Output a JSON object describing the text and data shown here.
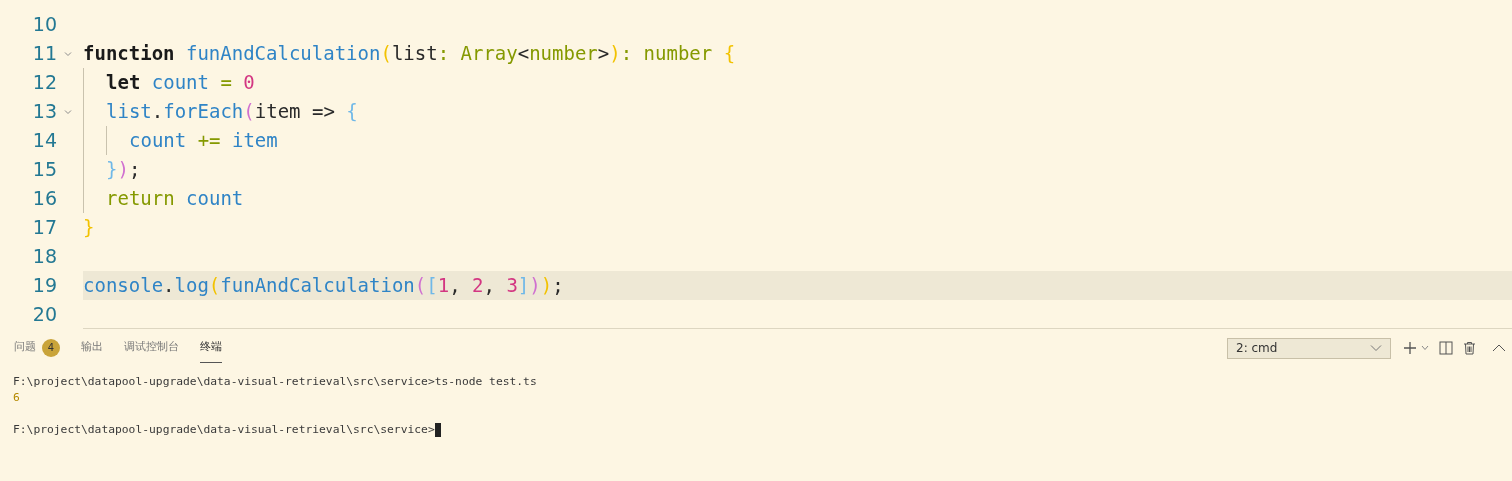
{
  "editor": {
    "lines": [
      {
        "number": "10"
      },
      {
        "number": "11",
        "expanded": true,
        "tokens": [
          {
            "kind": "keyword",
            "text": "function "
          },
          {
            "kind": "function",
            "text": "funAndCalculation"
          },
          {
            "kind": "bracket1",
            "text": "("
          },
          {
            "kind": "plain",
            "text": "list"
          },
          {
            "kind": "type",
            "text": ": Array"
          },
          {
            "kind": "plain",
            "text": "<"
          },
          {
            "kind": "type",
            "text": "number"
          },
          {
            "kind": "plain",
            "text": ">"
          },
          {
            "kind": "bracket1",
            "text": ")"
          },
          {
            "kind": "type",
            "text": ": number "
          },
          {
            "kind": "bracket1",
            "text": "{"
          }
        ],
        "children": [
          {
            "number": "12",
            "tokens": [
              {
                "kind": "keyword",
                "text": "let "
              },
              {
                "kind": "variable",
                "text": "count"
              },
              {
                "kind": "type",
                "text": " = "
              },
              {
                "kind": "number",
                "text": "0"
              }
            ]
          },
          {
            "number": "13",
            "expanded": true,
            "tokens": [
              {
                "kind": "variable",
                "text": "list"
              },
              {
                "kind": "plain",
                "text": "."
              },
              {
                "kind": "function",
                "text": "forEach"
              },
              {
                "kind": "bracket2",
                "text": "("
              },
              {
                "kind": "plain",
                "text": "item => "
              },
              {
                "kind": "bracket3",
                "text": "{"
              }
            ],
            "children": [
              {
                "number": "14",
                "tokens": [
                  {
                    "kind": "variable",
                    "text": "count"
                  },
                  {
                    "kind": "type",
                    "text": " += "
                  },
                  {
                    "kind": "variable",
                    "text": "item"
                  }
                ]
              }
            ]
          },
          {
            "number": "15",
            "tokens": [
              {
                "kind": "bracket3",
                "text": "}"
              },
              {
                "kind": "bracket2",
                "text": ")"
              },
              {
                "kind": "plain",
                "text": ";"
              }
            ]
          },
          {
            "number": "16",
            "tokens": [
              {
                "kind": "control",
                "text": "return "
              },
              {
                "kind": "variable",
                "text": "count"
              }
            ]
          }
        ]
      },
      {
        "number": "17",
        "tokens": [
          {
            "kind": "bracket1",
            "text": "}"
          }
        ]
      },
      {
        "number": "18"
      },
      {
        "number": "19",
        "current": true,
        "tokens": [
          {
            "kind": "variable",
            "text": "console"
          },
          {
            "kind": "plain",
            "text": "."
          },
          {
            "kind": "function",
            "text": "log"
          },
          {
            "kind": "bracket1",
            "text": "("
          },
          {
            "kind": "function",
            "text": "funAndCalculation"
          },
          {
            "kind": "bracket2",
            "text": "("
          },
          {
            "kind": "bracket3",
            "text": "["
          },
          {
            "kind": "number",
            "text": "1"
          },
          {
            "kind": "plain",
            "text": ", "
          },
          {
            "kind": "number",
            "text": "2"
          },
          {
            "kind": "plain",
            "text": ", "
          },
          {
            "kind": "number",
            "text": "3"
          },
          {
            "kind": "bracket3",
            "text": "]"
          },
          {
            "kind": "bracket2",
            "text": ")"
          },
          {
            "kind": "bracket1",
            "text": ")"
          },
          {
            "kind": "plain",
            "text": ";"
          }
        ]
      },
      {
        "number": "20"
      }
    ]
  },
  "panel": {
    "tabs": [
      {
        "label": "问题",
        "badge": "4",
        "selected": false
      },
      {
        "label": "输出",
        "selected": false
      },
      {
        "label": "调试控制台",
        "selected": false
      },
      {
        "label": "终端",
        "selected": true
      }
    ],
    "terminal_select": {
      "value": "2: cmd"
    },
    "terminal": [
      {
        "kind": "command",
        "text": "F:\\project\\datapool-upgrade\\data-visual-retrieval\\src\\service>ts-node test.ts"
      },
      {
        "kind": "output",
        "text": "6"
      },
      {
        "kind": "blank"
      },
      {
        "kind": "prompt",
        "text": "F:\\project\\datapool-upgrade\\data-visual-retrieval\\src\\service>",
        "cursor": true
      }
    ]
  }
}
